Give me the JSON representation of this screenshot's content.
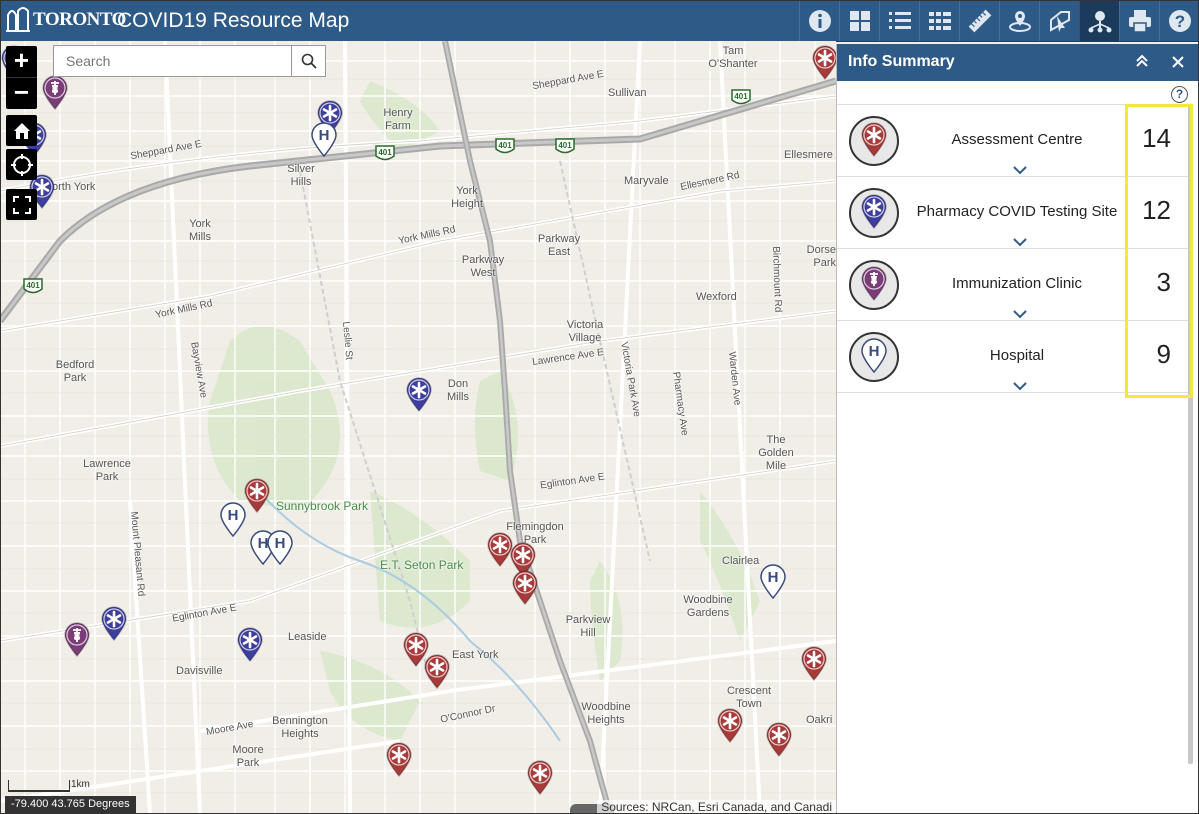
{
  "app": {
    "logo_text": "TORONTO",
    "title": "COVID19 Resource Map"
  },
  "toolbar": {
    "icons": [
      "info-icon",
      "basemap-gallery-icon",
      "legend-icon",
      "layer-list-icon",
      "measure-icon",
      "locate-icon",
      "draw-icon",
      "info-summary-icon",
      "print-icon",
      "help-icon"
    ],
    "active": "info-summary-icon"
  },
  "map": {
    "search": {
      "placeholder": "Search",
      "value": ""
    },
    "zoom_in": "+",
    "zoom_out": "−",
    "coordinates": "-79.400 43.765 Degrees",
    "scale_label": "1km",
    "attribution": "Sources: NRCan, Esri Canada, and Canadi",
    "labels": {
      "tam_oshanter": "Tam O'Shanter",
      "sullivan": "Sullivan",
      "henry_farm": "Henry Farm",
      "silver_hills": "Silver Hills",
      "north_york": "orth York",
      "york_height": "York Height",
      "maryvale": "Maryvale",
      "ellesmere": "Ellesmere",
      "york_mills": "York Mills",
      "parkway_east": "Parkway East",
      "parkway_west": "Parkway West",
      "dorset_park": "Dorse Park",
      "wexford": "Wexford",
      "victoria_village": "Victoria Village",
      "bedford_park": "Bedford Park",
      "don_mills": "Don Mills",
      "lawrence_park": "Lawrence Park",
      "the_golden_mile": "The Golden Mile",
      "sunnybrook_park": "Sunnybrook Park",
      "flemingdon_park": "Flemingdon Park",
      "et_seton_park": "E.T. Seton Park",
      "clairlea": "Clairlea",
      "woodbine_gardens": "Woodbine Gardens",
      "parkview_hill": "Parkview Hill",
      "leaside": "Leaside",
      "davisville": "Davisville",
      "east_york": "East York",
      "crescent_town": "Crescent Town",
      "oakridge": "Oakri",
      "bennington_heights": "Bennington Heights",
      "woodbine_heights": "Woodbine Heights",
      "moore_park": "Moore Park",
      "sheppard_ave_e": "Sheppard Ave E",
      "sheppard_ave_e_2": "Sheppard Ave E",
      "york_mills_rd": "York Mills Rd",
      "york_mills_rd_2": "York Mills Rd",
      "ellesmere_rd": "Ellesmere Rd",
      "lawrence_ave_e": "Lawrence Ave E",
      "eglinton_ave_e": "Eglinton Ave E",
      "eglinton_ave_e_2": "Eglinton Ave E",
      "moore_ave": "Moore Ave",
      "oconnor_dr": "O'Connor Dr",
      "bayview_ave": "Bayview Ave",
      "leslie_st": "Leslie St",
      "mount_pleasant_rd": "Mount Pleasant Rd",
      "victoria_park_ave": "Victoria Park Ave",
      "pharmacy_ave": "Pharmacy Ave",
      "warden_ave": "Warden Ave",
      "birchmount_rd": "Birchmount Rd",
      "hwy_401": "401"
    }
  },
  "panel": {
    "title": "Info Summary",
    "help": "?",
    "items": [
      {
        "name": "Assessment Centre",
        "count": "14",
        "icon": "assessment-centre-icon",
        "color": "#a83a3a"
      },
      {
        "name": "Pharmacy COVID Testing Site",
        "count": "12",
        "icon": "pharmacy-testing-icon",
        "color": "#3d3e9e"
      },
      {
        "name": "Immunization Clinic",
        "count": "3",
        "icon": "immunization-clinic-icon",
        "color": "#7a3d78"
      },
      {
        "name": "Hospital",
        "count": "9",
        "icon": "hospital-icon",
        "color": "#ffffff"
      }
    ]
  },
  "colors": {
    "header": "#2e5a88",
    "assessment": "#a83a3a",
    "pharmacy": "#3d3e9e",
    "immunization": "#7a3d78",
    "highlight": "#f5e83a"
  }
}
